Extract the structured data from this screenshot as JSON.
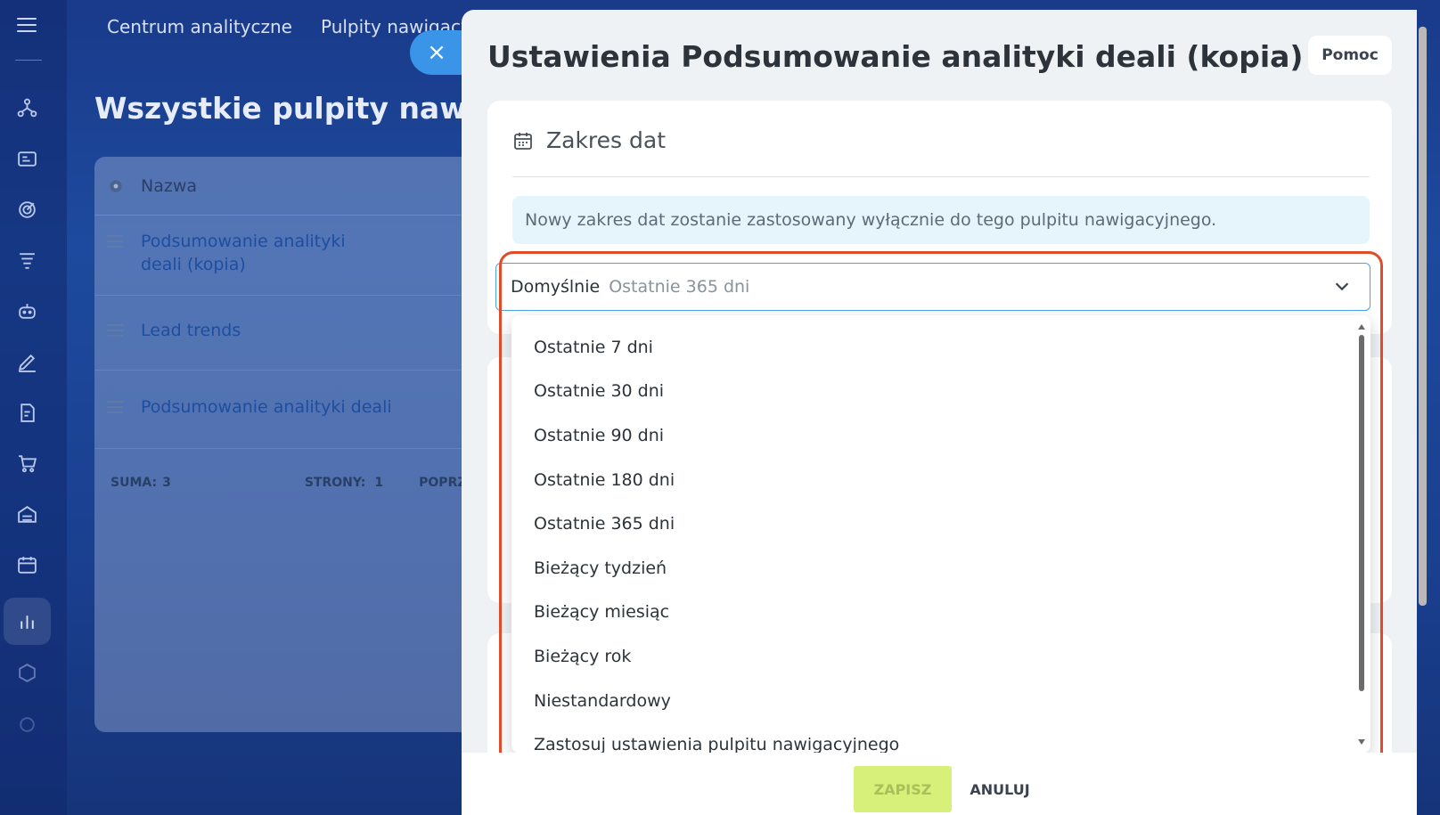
{
  "topnav": {
    "items": [
      "Centrum analityczne",
      "Pulpity nawigacyjne"
    ]
  },
  "page": {
    "title": "Wszystkie pulpity nawigac"
  },
  "table": {
    "column_name": "Nazwa",
    "rows": [
      "Podsumowanie analityki deali (kopia)",
      "Lead trends",
      "Podsumowanie analityki deali"
    ],
    "footer": {
      "total_label": "SUMA:",
      "total_value": "3",
      "pages_label": "STRONY:",
      "pages_value": "1",
      "prev_label": "POPRZ"
    }
  },
  "slider": {
    "title": "Ustawienia Podsumowanie analityki deali (kopia)",
    "help_label": "Pomoc",
    "section": {
      "title": "Zakres dat",
      "notice": "Nowy zakres dat zostanie zastosowany wyłącznie do tego pulpitu nawigacyjnego."
    },
    "select": {
      "label": "Domyślnie",
      "value": "Ostatnie 365 dni"
    },
    "options": [
      "Ostatnie 7 dni",
      "Ostatnie 30 dni",
      "Ostatnie 90 dni",
      "Ostatnie 180 dni",
      "Ostatnie 365 dni",
      "Bieżący tydzień",
      "Bieżący miesiąc",
      "Bieżący rok",
      "Niestandardowy",
      "Zastosuj ustawienia pulpitu nawigacyjnego"
    ],
    "save_label": "ZAPISZ",
    "cancel_label": "ANULUJ"
  },
  "colors": {
    "accent": "#3a95e8",
    "highlight": "#e04b2a",
    "save": "#d6f07a"
  }
}
